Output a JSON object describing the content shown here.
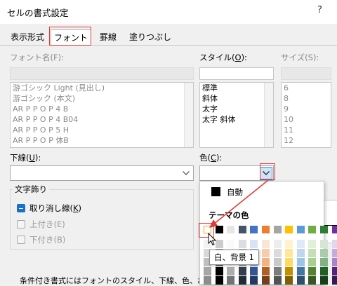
{
  "dialog": {
    "title": "セルの書式設定",
    "help": "?"
  },
  "tabs": [
    "表示形式",
    "フォント",
    "罫線",
    "塗りつぶし"
  ],
  "font": {
    "label": "フォント名(F):",
    "items": [
      "游ゴシック Light (見出し)",
      "游ゴシック (本文)",
      "AR P P O P 4 B",
      "AR P P O P 4 B04",
      "AR P P O P 5 H",
      "AR P P O P 体B"
    ]
  },
  "style": {
    "label_pre": "スタイル(",
    "label_key": "O",
    "label_post": "):",
    "items": [
      "標準",
      "斜体",
      "太字",
      "太字 斜体"
    ]
  },
  "size": {
    "label": "サイズ(S):",
    "items": [
      "6",
      "8",
      "9",
      "10",
      "11",
      "12"
    ]
  },
  "underline": {
    "label_pre": "下線(",
    "label_key": "U",
    "label_post": "):"
  },
  "color": {
    "label_pre": "色(",
    "label_key": "C",
    "label_post": "):"
  },
  "effects": {
    "legend": "文字飾り",
    "strike": "取り消し線(",
    "strike_key": "K",
    "strike_post": ")",
    "superscript": "上付き(E)",
    "subscript": "下付き(B)"
  },
  "palette": {
    "auto": "自動",
    "theme_label": "テーマの色",
    "tooltip": "白、背景 1",
    "theme_colors": [
      "#ffffff",
      "#000000",
      "#e7e6e6",
      "#44546a",
      "#4472c4",
      "#ed7d31",
      "#a5a5a5",
      "#ffc000",
      "#5b9bd5",
      "#70ad47",
      "#2f7d32",
      "#7030a0"
    ],
    "highlight": "#e53935"
  },
  "footer": {
    "text": "条件付き書式にはフォントのスタイル、下線、色、および取"
  }
}
